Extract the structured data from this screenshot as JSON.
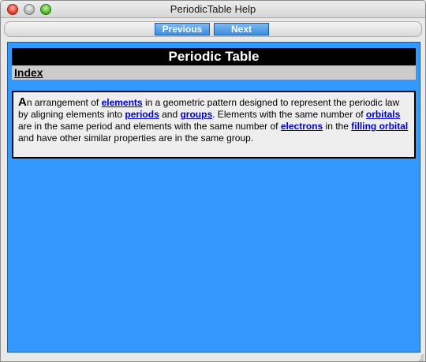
{
  "window": {
    "title": "PeriodicTable Help"
  },
  "toolbar": {
    "previous_label": "Previous",
    "next_label": "Next"
  },
  "page": {
    "heading": "Periodic Table",
    "index_link": "Index",
    "definition": {
      "initial": "A",
      "t1": "n arrangement of ",
      "link_elements": "elements",
      "t2": " in a geometric pattern designed to represent the periodic law by aligning elements into ",
      "link_periods": "periods",
      "t3": " and ",
      "link_groups": "groups",
      "t4": ". Elements with the same number of ",
      "link_orbitals": "orbitals",
      "t5": " are in the same period and elements with the same number of ",
      "link_electrons": "electrons",
      "t6": " in the ",
      "link_filling_orbital": "filling orbital",
      "t7": " and have other similar properties are in the same group."
    }
  },
  "colors": {
    "content_background": "#3399ff",
    "heading_background": "#000000",
    "index_background": "#cccccc",
    "link": "#0000cc"
  }
}
